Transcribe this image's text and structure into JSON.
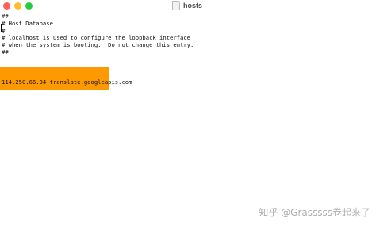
{
  "window": {
    "title": "hosts",
    "file_icon": "text-document-icon"
  },
  "editor": {
    "lines": [
      "##",
      "# Host Database",
      "#",
      "# localhost is used to configure the loopback interface",
      "# when the system is booting.  Do not change this entry.",
      "##",
      "114.250.66.34 translate.googleapis.com"
    ],
    "redaction_color": "#ff9900"
  },
  "watermark": {
    "text": "知乎 @Grasssss卷起来了"
  },
  "colors": {
    "traffic_close": "#fe5f57",
    "traffic_minimize": "#febc2e",
    "traffic_zoom": "#28c840"
  }
}
